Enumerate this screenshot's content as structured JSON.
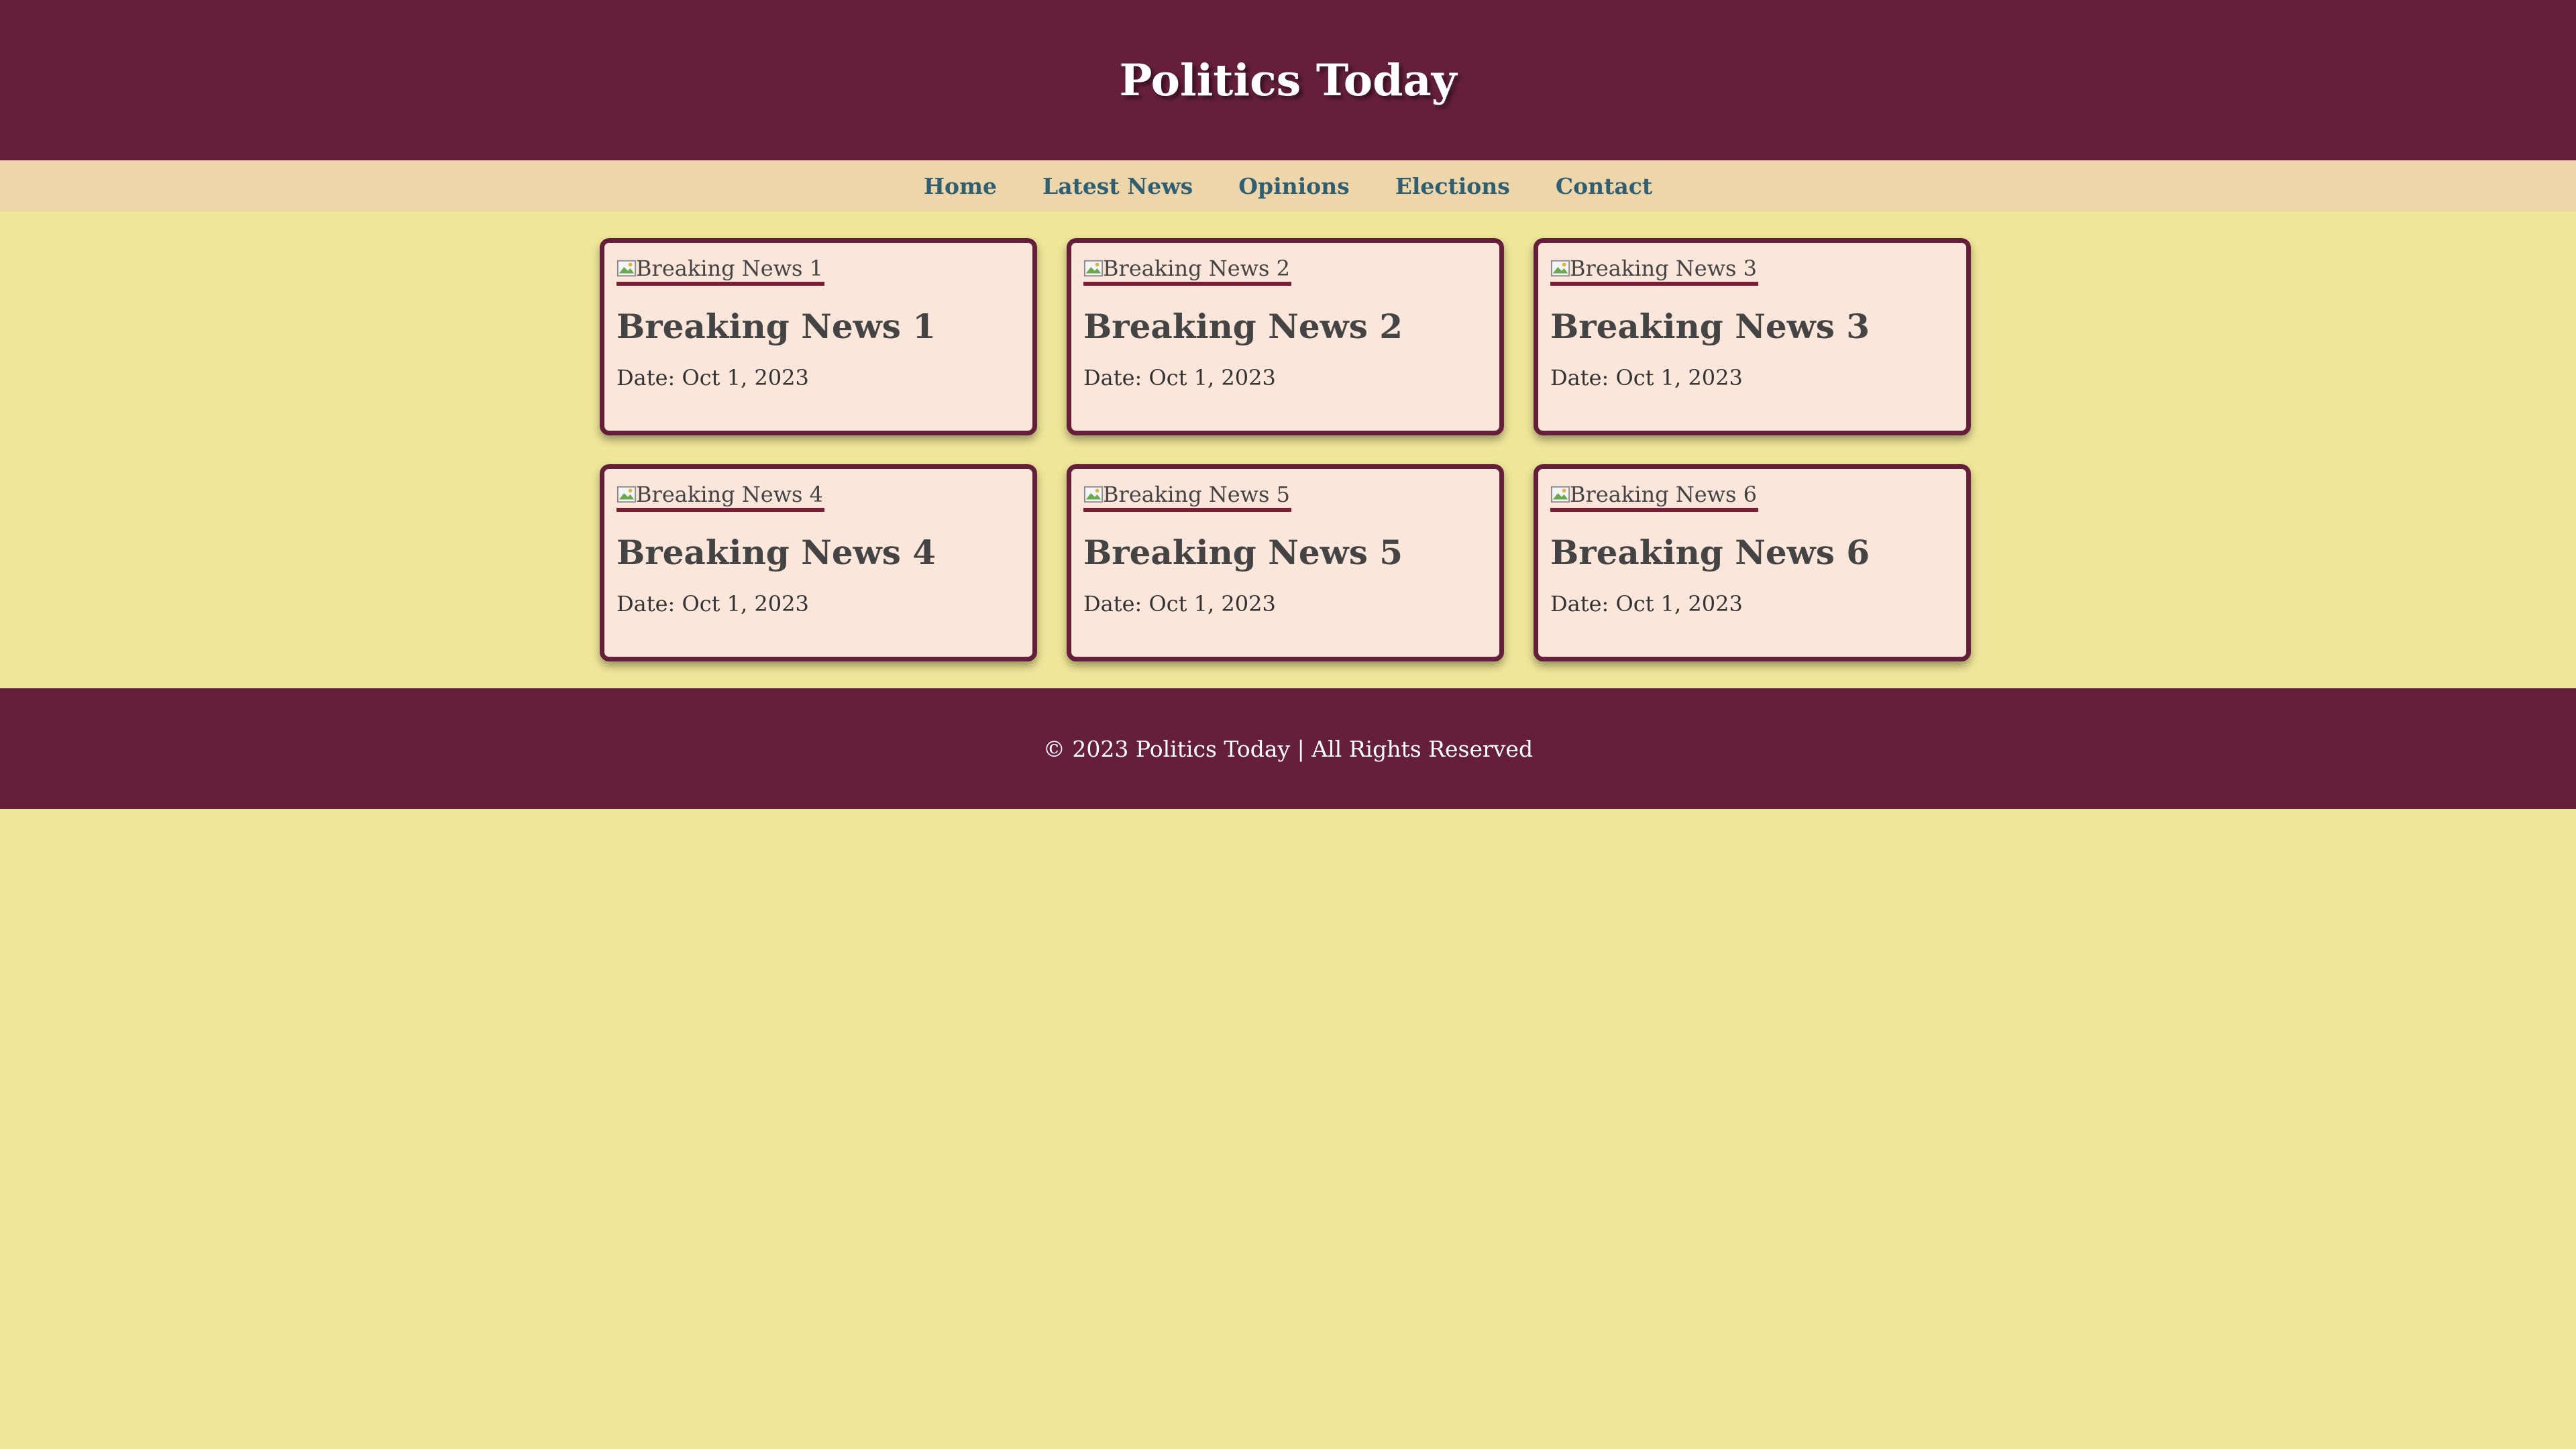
{
  "colors": {
    "header_bg": "#651F3B",
    "nav_bg": "#EED5AA",
    "page_bg": "#EEE698",
    "card_bg": "#FAE6DA",
    "card_border": "#651F3B",
    "nav_link": "#2F5F73"
  },
  "header": {
    "title": "Politics Today"
  },
  "nav": {
    "items": [
      {
        "label": "Home"
      },
      {
        "label": "Latest News"
      },
      {
        "label": "Opinions"
      },
      {
        "label": "Elections"
      },
      {
        "label": "Contact"
      }
    ]
  },
  "articles": [
    {
      "image_alt": "Breaking News 1",
      "title": "Breaking News 1",
      "date": "Date: Oct 1, 2023"
    },
    {
      "image_alt": "Breaking News 2",
      "title": "Breaking News 2",
      "date": "Date: Oct 1, 2023"
    },
    {
      "image_alt": "Breaking News 3",
      "title": "Breaking News 3",
      "date": "Date: Oct 1, 2023"
    },
    {
      "image_alt": "Breaking News 4",
      "title": "Breaking News 4",
      "date": "Date: Oct 1, 2023"
    },
    {
      "image_alt": "Breaking News 5",
      "title": "Breaking News 5",
      "date": "Date: Oct 1, 2023"
    },
    {
      "image_alt": "Breaking News 6",
      "title": "Breaking News 6",
      "date": "Date: Oct 1, 2023"
    }
  ],
  "footer": {
    "text": "© 2023 Politics Today | All Rights Reserved"
  }
}
